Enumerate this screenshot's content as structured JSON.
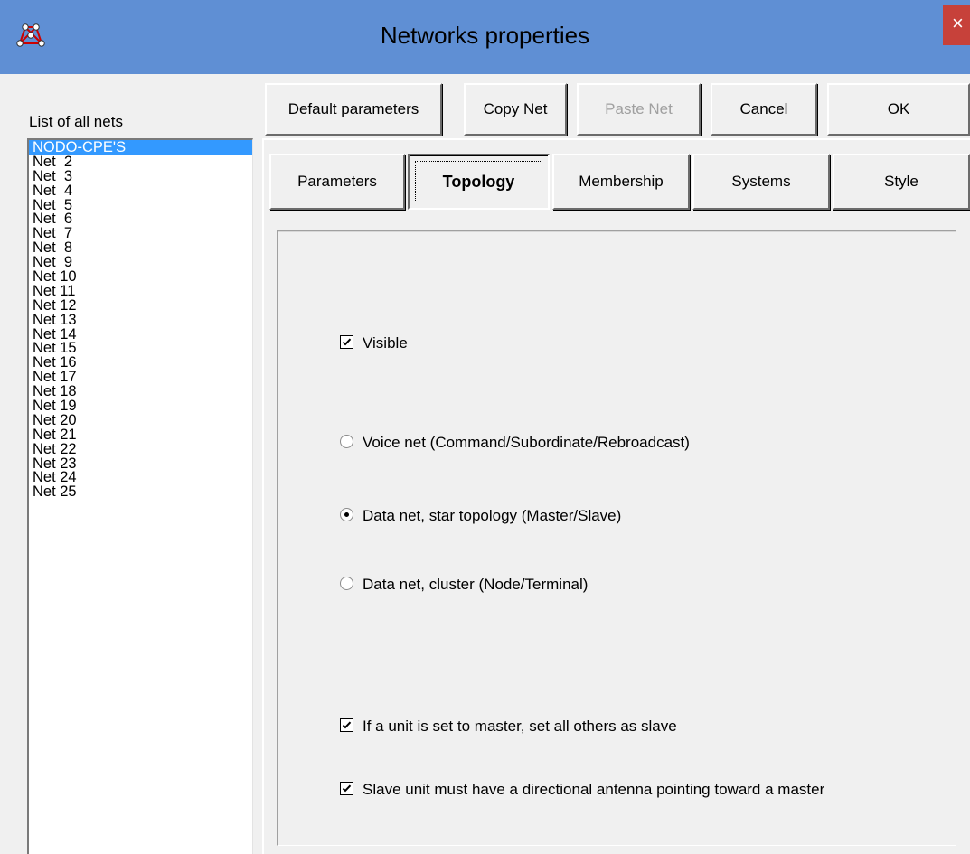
{
  "window": {
    "title": "Networks properties",
    "close_glyph": "×"
  },
  "list": {
    "label": "List of all nets",
    "items": [
      "NODO-CPE'S",
      "Net  2",
      "Net  3",
      "Net  4",
      "Net  5",
      "Net  6",
      "Net  7",
      "Net  8",
      "Net  9",
      "Net 10",
      "Net 11",
      "Net 12",
      "Net 13",
      "Net 14",
      "Net 15",
      "Net 16",
      "Net 17",
      "Net 18",
      "Net 19",
      "Net 20",
      "Net 21",
      "Net 22",
      "Net 23",
      "Net 24",
      "Net 25"
    ],
    "selected_index": 0
  },
  "toolbar": {
    "default_label": "Default parameters",
    "copy_label": "Copy Net",
    "paste_label": "Paste Net",
    "cancel_label": "Cancel",
    "ok_label": "OK"
  },
  "tabs": {
    "parameters": "Parameters",
    "topology": "Topology",
    "membership": "Membership",
    "systems": "Systems",
    "style": "Style",
    "active": "Topology"
  },
  "topology": {
    "visible_label": "Visible",
    "visible_checked": true,
    "voice_label": "Voice net (Command/Subordinate/Rebroadcast)",
    "star_label": "Data net, star topology (Master/Slave)",
    "cluster_label": "Data net, cluster (Node/Terminal)",
    "selected_topology": "star",
    "master_label": "If a unit is set to master, set all others as slave",
    "master_checked": true,
    "antenna_label": "Slave unit must have a directional antenna pointing toward a master",
    "antenna_checked": true
  },
  "icons": {
    "app": "network-app-icon",
    "close": "close-icon"
  },
  "colors": {
    "titlebar": "#5f8fd4",
    "selection": "#3399ff",
    "close": "#c7413a"
  }
}
